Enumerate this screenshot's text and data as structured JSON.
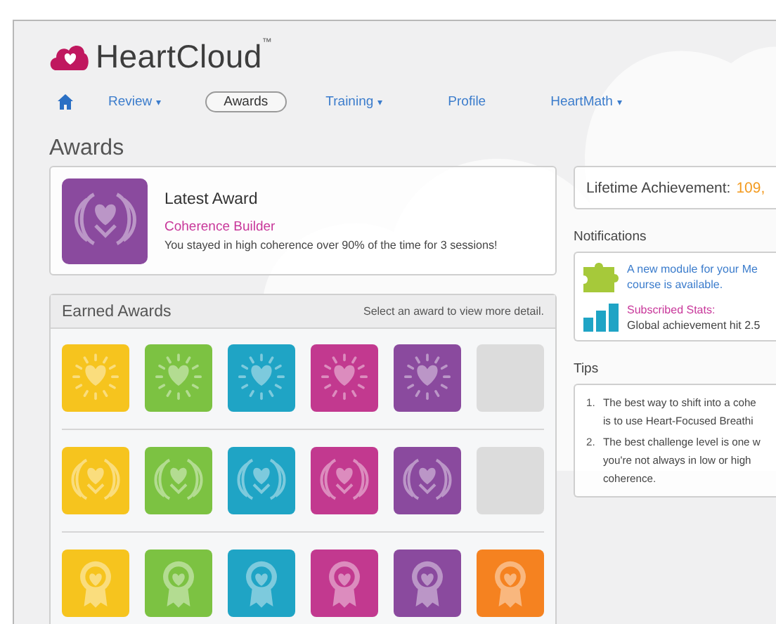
{
  "brand": {
    "name": "HeartCloud",
    "trademark": "™"
  },
  "nav": [
    {
      "kind": "home",
      "selected": false
    },
    {
      "kind": "link",
      "label": "Review",
      "dropdown": true,
      "selected": false
    },
    {
      "kind": "link",
      "label": "Awards",
      "dropdown": false,
      "selected": true
    },
    {
      "kind": "link",
      "label": "Training",
      "dropdown": true,
      "selected": false
    },
    {
      "kind": "link",
      "label": "Profile",
      "dropdown": false,
      "selected": false
    },
    {
      "kind": "link",
      "label": "HeartMath",
      "dropdown": true,
      "selected": false
    }
  ],
  "caret": "▾",
  "page_title": "Awards",
  "latest_award": {
    "heading": "Latest Award",
    "kind": "rings",
    "color": "#8a4a9e",
    "name": "Coherence Builder",
    "description": "You stayed in high coherence over 90% of the time for 3 sessions!"
  },
  "earned_awards": {
    "title": "Earned Awards",
    "hint": "Select an award to view more detail.",
    "rows": [
      [
        {
          "kind": "sun",
          "color": "#f6c41e"
        },
        {
          "kind": "sun",
          "color": "#7cc242"
        },
        {
          "kind": "sun",
          "color": "#1fa4c5"
        },
        {
          "kind": "sun",
          "color": "#c2398f"
        },
        {
          "kind": "sun",
          "color": "#8a4a9e"
        },
        {
          "kind": "empty"
        }
      ],
      [
        {
          "kind": "rings",
          "color": "#f6c41e"
        },
        {
          "kind": "rings",
          "color": "#7cc242"
        },
        {
          "kind": "rings",
          "color": "#1fa4c5"
        },
        {
          "kind": "rings",
          "color": "#c2398f"
        },
        {
          "kind": "rings",
          "color": "#8a4a9e"
        },
        {
          "kind": "empty"
        }
      ],
      [
        {
          "kind": "ribbon",
          "color": "#f6c41e"
        },
        {
          "kind": "ribbon",
          "color": "#7cc242"
        },
        {
          "kind": "ribbon",
          "color": "#1fa4c5"
        },
        {
          "kind": "ribbon",
          "color": "#c2398f"
        },
        {
          "kind": "ribbon",
          "color": "#8a4a9e"
        },
        {
          "kind": "ribbon",
          "color": "#f58220"
        }
      ]
    ]
  },
  "lifetime": {
    "label": "Lifetime Achievement:",
    "value": "109,"
  },
  "notifications": {
    "title": "Notifications",
    "items": [
      {
        "kind": "puzzle",
        "lines": [
          "A new module for your Me",
          "course is available."
        ]
      },
      {
        "kind": "stats",
        "title": "Subscribed Stats:",
        "lines": [
          "Global achievement hit 2.5"
        ]
      }
    ]
  },
  "tips": {
    "title": "Tips",
    "items": [
      {
        "number": "1.",
        "lines": [
          "The best way to shift into a cohe",
          "is to use Heart-Focused Breathi"
        ]
      },
      {
        "number": "2.",
        "lines": [
          "The best challenge level is one w",
          "you're not always in low or high",
          "coherence."
        ]
      }
    ]
  }
}
